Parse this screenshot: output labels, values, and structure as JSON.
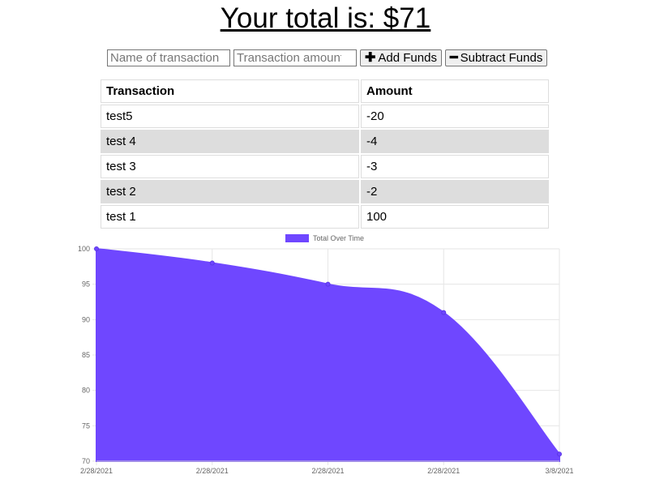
{
  "header": {
    "prefix": "Your total is: $",
    "total": "71"
  },
  "form": {
    "name_placeholder": "Name of transaction",
    "amount_placeholder": "Transaction amount",
    "add_label": "Add Funds",
    "subtract_label": "Subtract Funds",
    "add_icon": "plus-icon",
    "subtract_icon": "minus-icon"
  },
  "table": {
    "headers": [
      "Transaction",
      "Amount"
    ],
    "rows": [
      {
        "name": "test5",
        "amount": "-20"
      },
      {
        "name": "test 4",
        "amount": "-4"
      },
      {
        "name": "test 3",
        "amount": "-3"
      },
      {
        "name": "test 2",
        "amount": "-2"
      },
      {
        "name": "test 1",
        "amount": "100"
      }
    ],
    "alt_row_color": "#dddddd"
  },
  "chart_data": {
    "type": "area",
    "categories": [
      "2/28/2021",
      "2/28/2021",
      "2/28/2021",
      "2/28/2021",
      "3/8/2021"
    ],
    "series": [
      {
        "name": "Total Over Time",
        "values": [
          100,
          98,
          95,
          91,
          71
        ],
        "color": "#6f47ff"
      }
    ],
    "ylim": [
      70,
      100
    ],
    "yticks": [
      70,
      75,
      80,
      85,
      90,
      95,
      100
    ],
    "legend": "top-center",
    "grid": true
  }
}
